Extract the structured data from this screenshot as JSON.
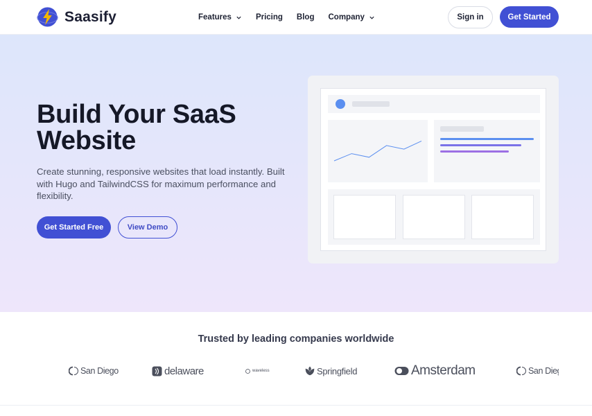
{
  "brand": {
    "name": "Saasify",
    "logo_icon": "lightning-bolt-icon",
    "logo_colors": [
      "#3f4dc7",
      "#f5b700"
    ]
  },
  "nav": {
    "links": [
      {
        "label": "Features",
        "has_dropdown": true
      },
      {
        "label": "Pricing",
        "has_dropdown": false
      },
      {
        "label": "Blog",
        "has_dropdown": false
      },
      {
        "label": "Company",
        "has_dropdown": true
      }
    ],
    "signin_label": "Sign in",
    "cta_label": "Get Started"
  },
  "hero": {
    "title": "Build Your SaaS Website",
    "description": "Create stunning, responsive websites that load instantly. Built with Hugo and TailwindCSS for maximum performance and flexibility.",
    "primary_cta": "Get Started Free",
    "secondary_cta": "View Demo"
  },
  "mockup": {
    "chart_points": [
      20,
      36,
      28,
      54,
      46,
      64
    ]
  },
  "trusted": {
    "title": "Trusted by leading companies worldwide",
    "logos": [
      "San Diego",
      "delaware",
      "waveless",
      "Springfield",
      "Amsterdam",
      "San Diego"
    ]
  },
  "colors": {
    "accent": "#4150d4",
    "text_dark": "#151827",
    "hero_bg_top": "#dde6fb",
    "hero_bg_bottom": "#eee6fb"
  }
}
